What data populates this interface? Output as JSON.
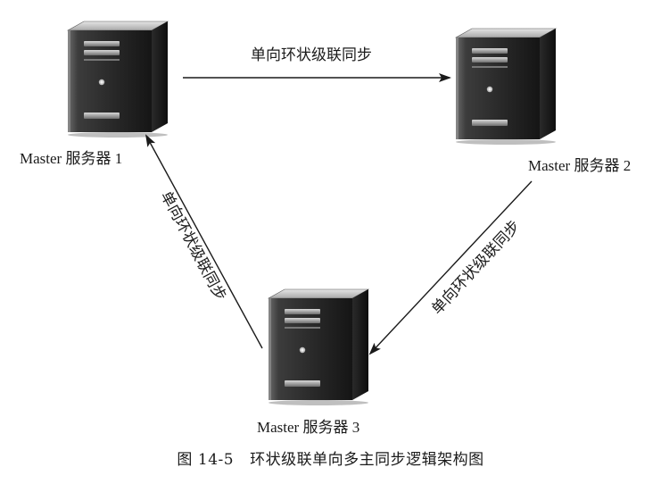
{
  "servers": [
    {
      "label": "Master 服务器 1"
    },
    {
      "label": "Master 服务器 2"
    },
    {
      "label": "Master 服务器 3"
    }
  ],
  "edges": [
    {
      "label": "单向环状级联同步"
    },
    {
      "label": "单向环状级联同步"
    },
    {
      "label": "单向环状级联同步"
    }
  ],
  "caption": {
    "prefix": "图",
    "number": "14-5",
    "text": "环状级联单向多主同步逻辑架构图"
  },
  "colors": {
    "line": "#1a1a1a",
    "server_dark": "#1f1f1f",
    "server_mid": "#4a4a4a",
    "server_light": "#c8c8c8"
  }
}
